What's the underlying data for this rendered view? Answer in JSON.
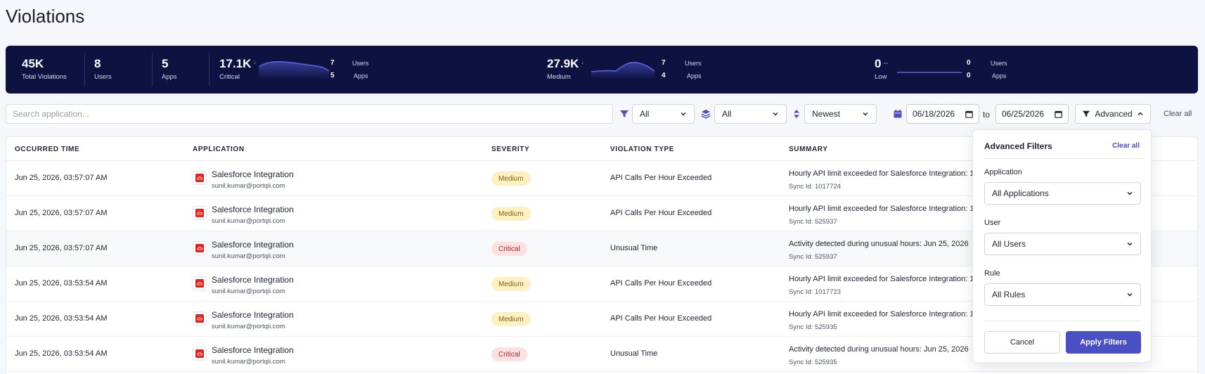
{
  "page": {
    "title": "Violations"
  },
  "stats": {
    "total_violations": {
      "value": "45K",
      "label": "Total Violations"
    },
    "users": {
      "value": "8",
      "label": "Users"
    },
    "apps": {
      "value": "5",
      "label": "Apps"
    },
    "critical": {
      "value": "17.1K",
      "label": "Critical",
      "trend": "↓",
      "users": "7",
      "apps": "5",
      "users_label": "Users",
      "apps_label": "Apps"
    },
    "medium": {
      "value": "27.9K",
      "label": "Medium",
      "trend": "↓",
      "users": "7",
      "apps": "4",
      "users_label": "Users",
      "apps_label": "Apps"
    },
    "low": {
      "value": "0",
      "label": "Low",
      "trend": "--",
      "users": "0",
      "apps": "0",
      "users_label": "Users",
      "apps_label": "Apps"
    },
    "spark_color": "#5a63e0"
  },
  "filters": {
    "search_placeholder": "Search application...",
    "severity": "All",
    "layer": "All",
    "sort": "Newest",
    "date_from": "06/18/2026",
    "to_label": "to",
    "date_to": "06/25/2026",
    "advanced_label": "Advanced",
    "clear_all": "Clear all"
  },
  "table": {
    "headers": [
      "OCCURRED TIME",
      "APPLICATION",
      "SEVERITY",
      "VIOLATION TYPE",
      "SUMMARY"
    ],
    "rows": [
      {
        "time": "Jun 25, 2026, 03:57:07 AM",
        "app": "Salesforce Integration",
        "user": "sunil.kumar@portqii.com",
        "severity": "Medium",
        "type": "API Calls Per Hour Exceeded",
        "summary": "Hourly API limit exceeded for Salesforce Integration: 1",
        "sync": "Sync Id: 1017724"
      },
      {
        "time": "Jun 25, 2026, 03:57:07 AM",
        "app": "Salesforce Integration",
        "user": "sunil.kumar@portqii.com",
        "severity": "Medium",
        "type": "API Calls Per Hour Exceeded",
        "summary": "Hourly API limit exceeded for Salesforce Integration: 1",
        "sync": "Sync Id: 525937"
      },
      {
        "time": "Jun 25, 2026, 03:57:07 AM",
        "app": "Salesforce Integration",
        "user": "sunil.kumar@portqii.com",
        "severity": "Critical",
        "type": "Unusual Time",
        "summary": "Activity detected during unusual hours: Jun 25, 2026",
        "sync": "Sync Id: 525937"
      },
      {
        "time": "Jun 25, 2026, 03:53:54 AM",
        "app": "Salesforce Integration",
        "user": "sunil.kumar@portqii.com",
        "severity": "Medium",
        "type": "API Calls Per Hour Exceeded",
        "summary": "Hourly API limit exceeded for Salesforce Integration: 1",
        "sync": "Sync Id: 1017723"
      },
      {
        "time": "Jun 25, 2026, 03:53:54 AM",
        "app": "Salesforce Integration",
        "user": "sunil.kumar@portqii.com",
        "severity": "Medium",
        "type": "API Calls Per Hour Exceeded",
        "summary": "Hourly API limit exceeded for Salesforce Integration: 1",
        "sync": "Sync Id: 525935"
      },
      {
        "time": "Jun 25, 2026, 03:53:54 AM",
        "app": "Salesforce Integration",
        "user": "sunil.kumar@portqii.com",
        "severity": "Critical",
        "type": "Unusual Time",
        "summary": "Activity detected during unusual hours: Jun 25, 2026",
        "sync": "Sync Id: 525935"
      }
    ]
  },
  "advanced_filters": {
    "title": "Advanced Filters",
    "clear_all": "Clear all",
    "application_label": "Application",
    "application_value": "All Applications",
    "user_label": "User",
    "user_value": "All Users",
    "rule_label": "Rule",
    "rule_value": "All Rules",
    "cancel": "Cancel",
    "apply": "Apply Filters"
  },
  "colors": {
    "accent": "#4a4fc4",
    "banner": "#0d1240",
    "medium_bg": "#fdf0c2",
    "critical_bg": "#fde1e1"
  }
}
